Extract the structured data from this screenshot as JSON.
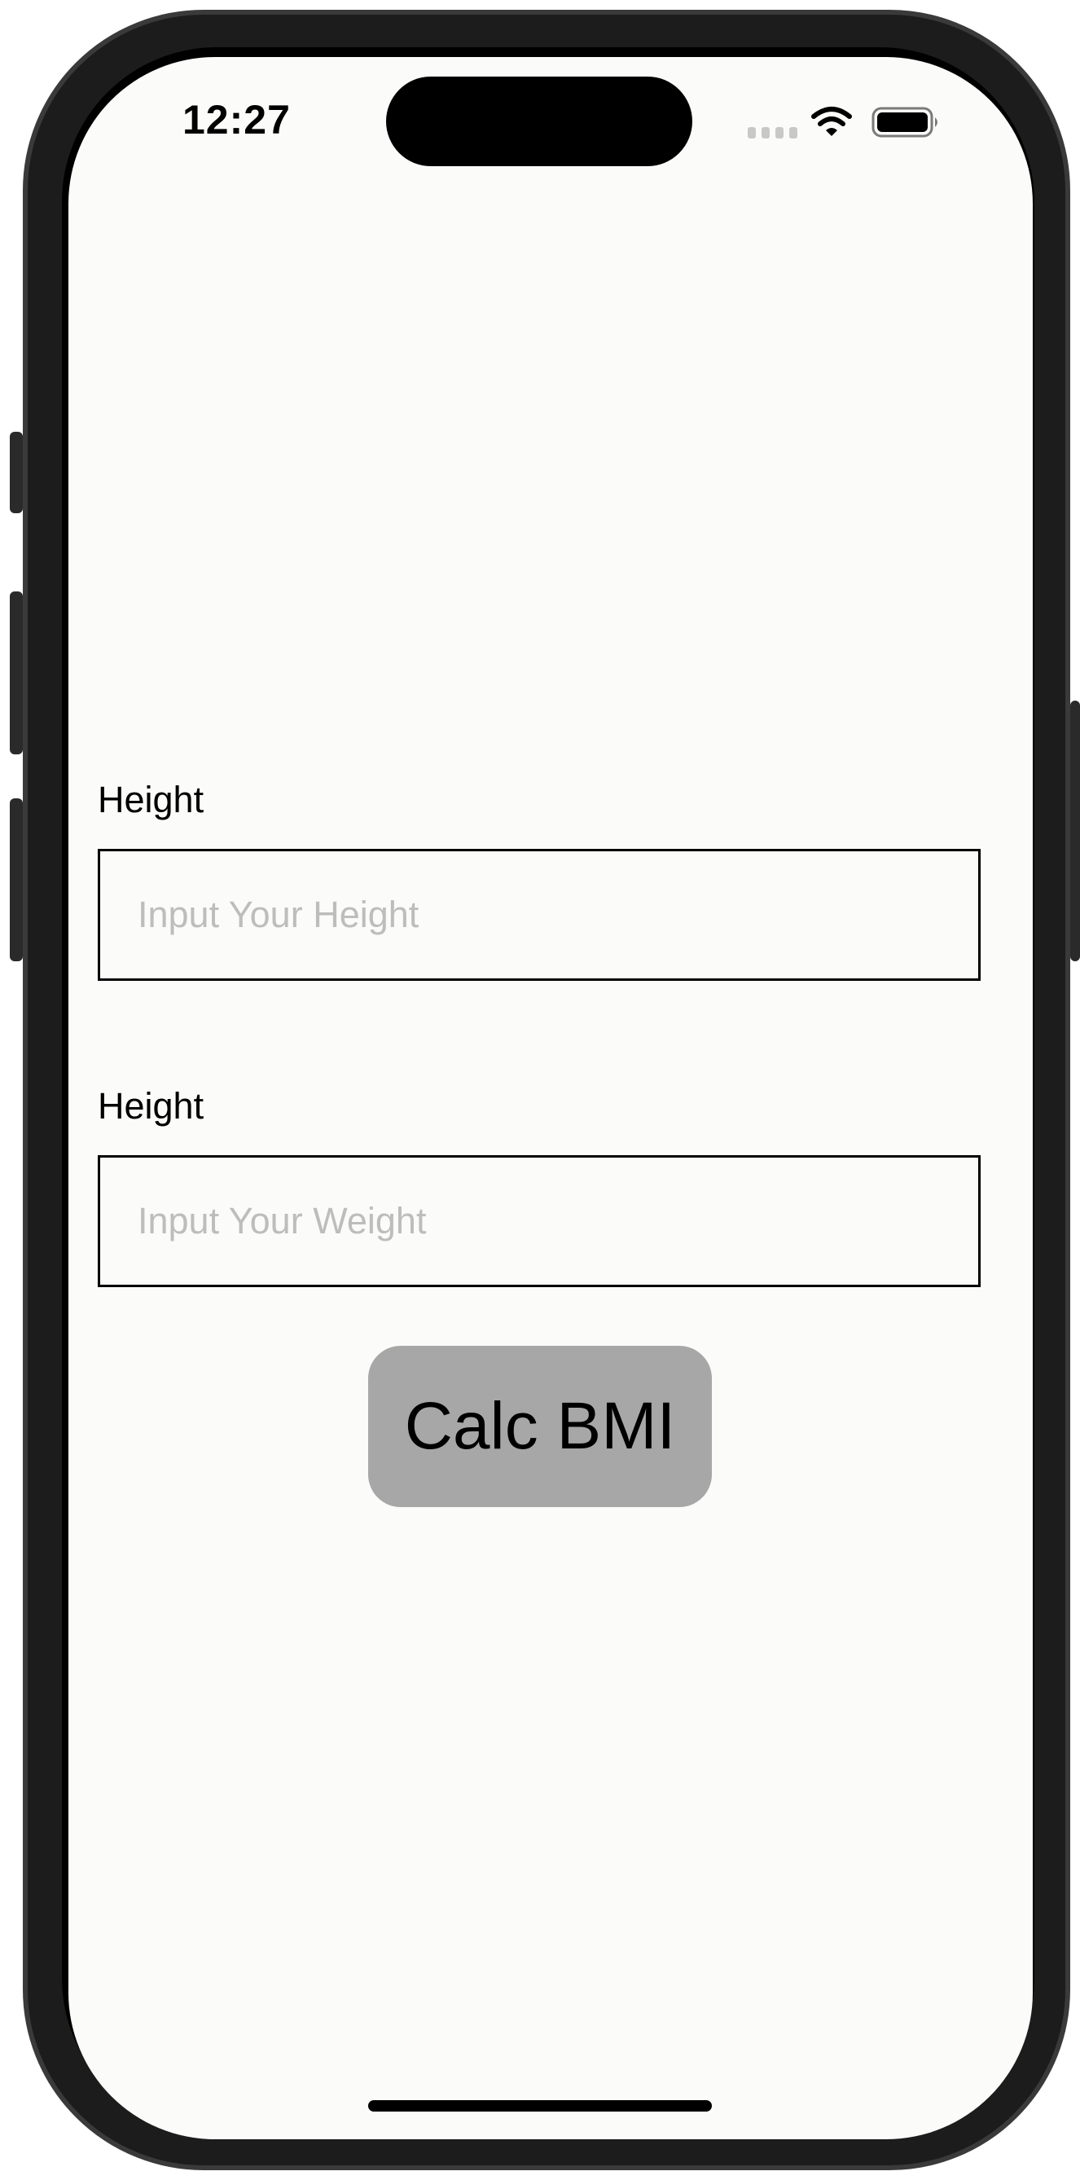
{
  "status_bar": {
    "time": "12:27",
    "icons": [
      "cellular-signal-icon",
      "wifi-icon",
      "battery-icon"
    ]
  },
  "form": {
    "height_field": {
      "label": "Height",
      "placeholder": "Input Your Height",
      "value": ""
    },
    "weight_field": {
      "label": "Height",
      "placeholder": "Input Your Weight",
      "value": ""
    },
    "calc_button": {
      "label": "Calc BMI"
    }
  },
  "colors": {
    "screen_background": "#fbfbfa",
    "button_background": "#a7a7a7",
    "placeholder_text": "#bdbdbd",
    "text": "#000000"
  }
}
